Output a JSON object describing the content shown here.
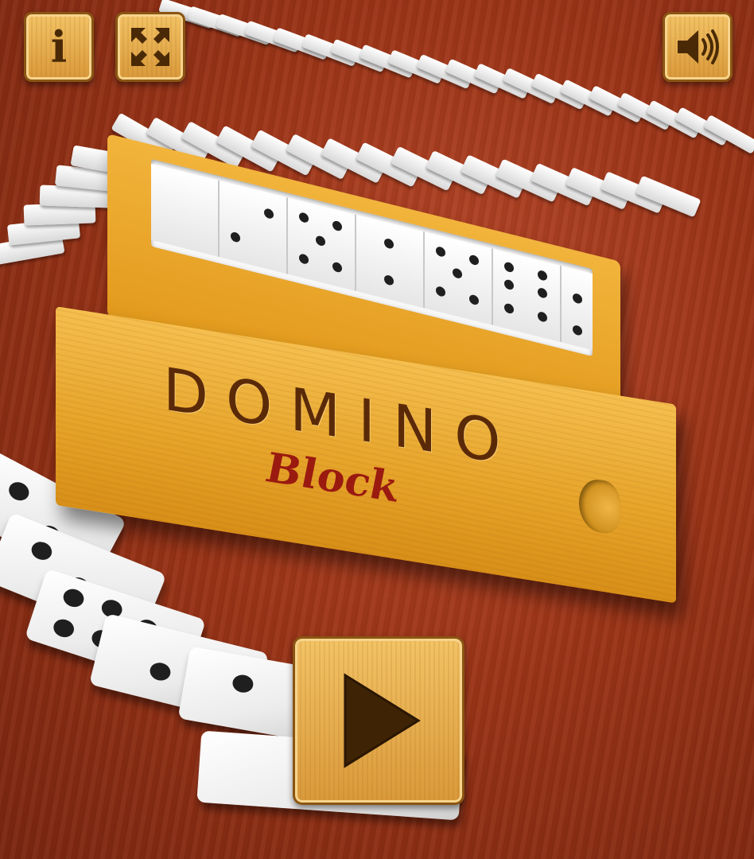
{
  "game": {
    "title": "DOMINO",
    "subtitle": "Block"
  },
  "toolbar": {
    "info_label": "i",
    "fullscreen_icon": "fullscreen-icon",
    "sound_icon": "speaker-icon"
  },
  "actions": {
    "play_icon": "play-icon"
  },
  "colors": {
    "table": "#9c3518",
    "wood": "#e7a52b",
    "title_text": "#5a2a08",
    "subtitle_text": "#9a1a10",
    "button_border": "#8a5513",
    "icon": "#4a2a06"
  }
}
